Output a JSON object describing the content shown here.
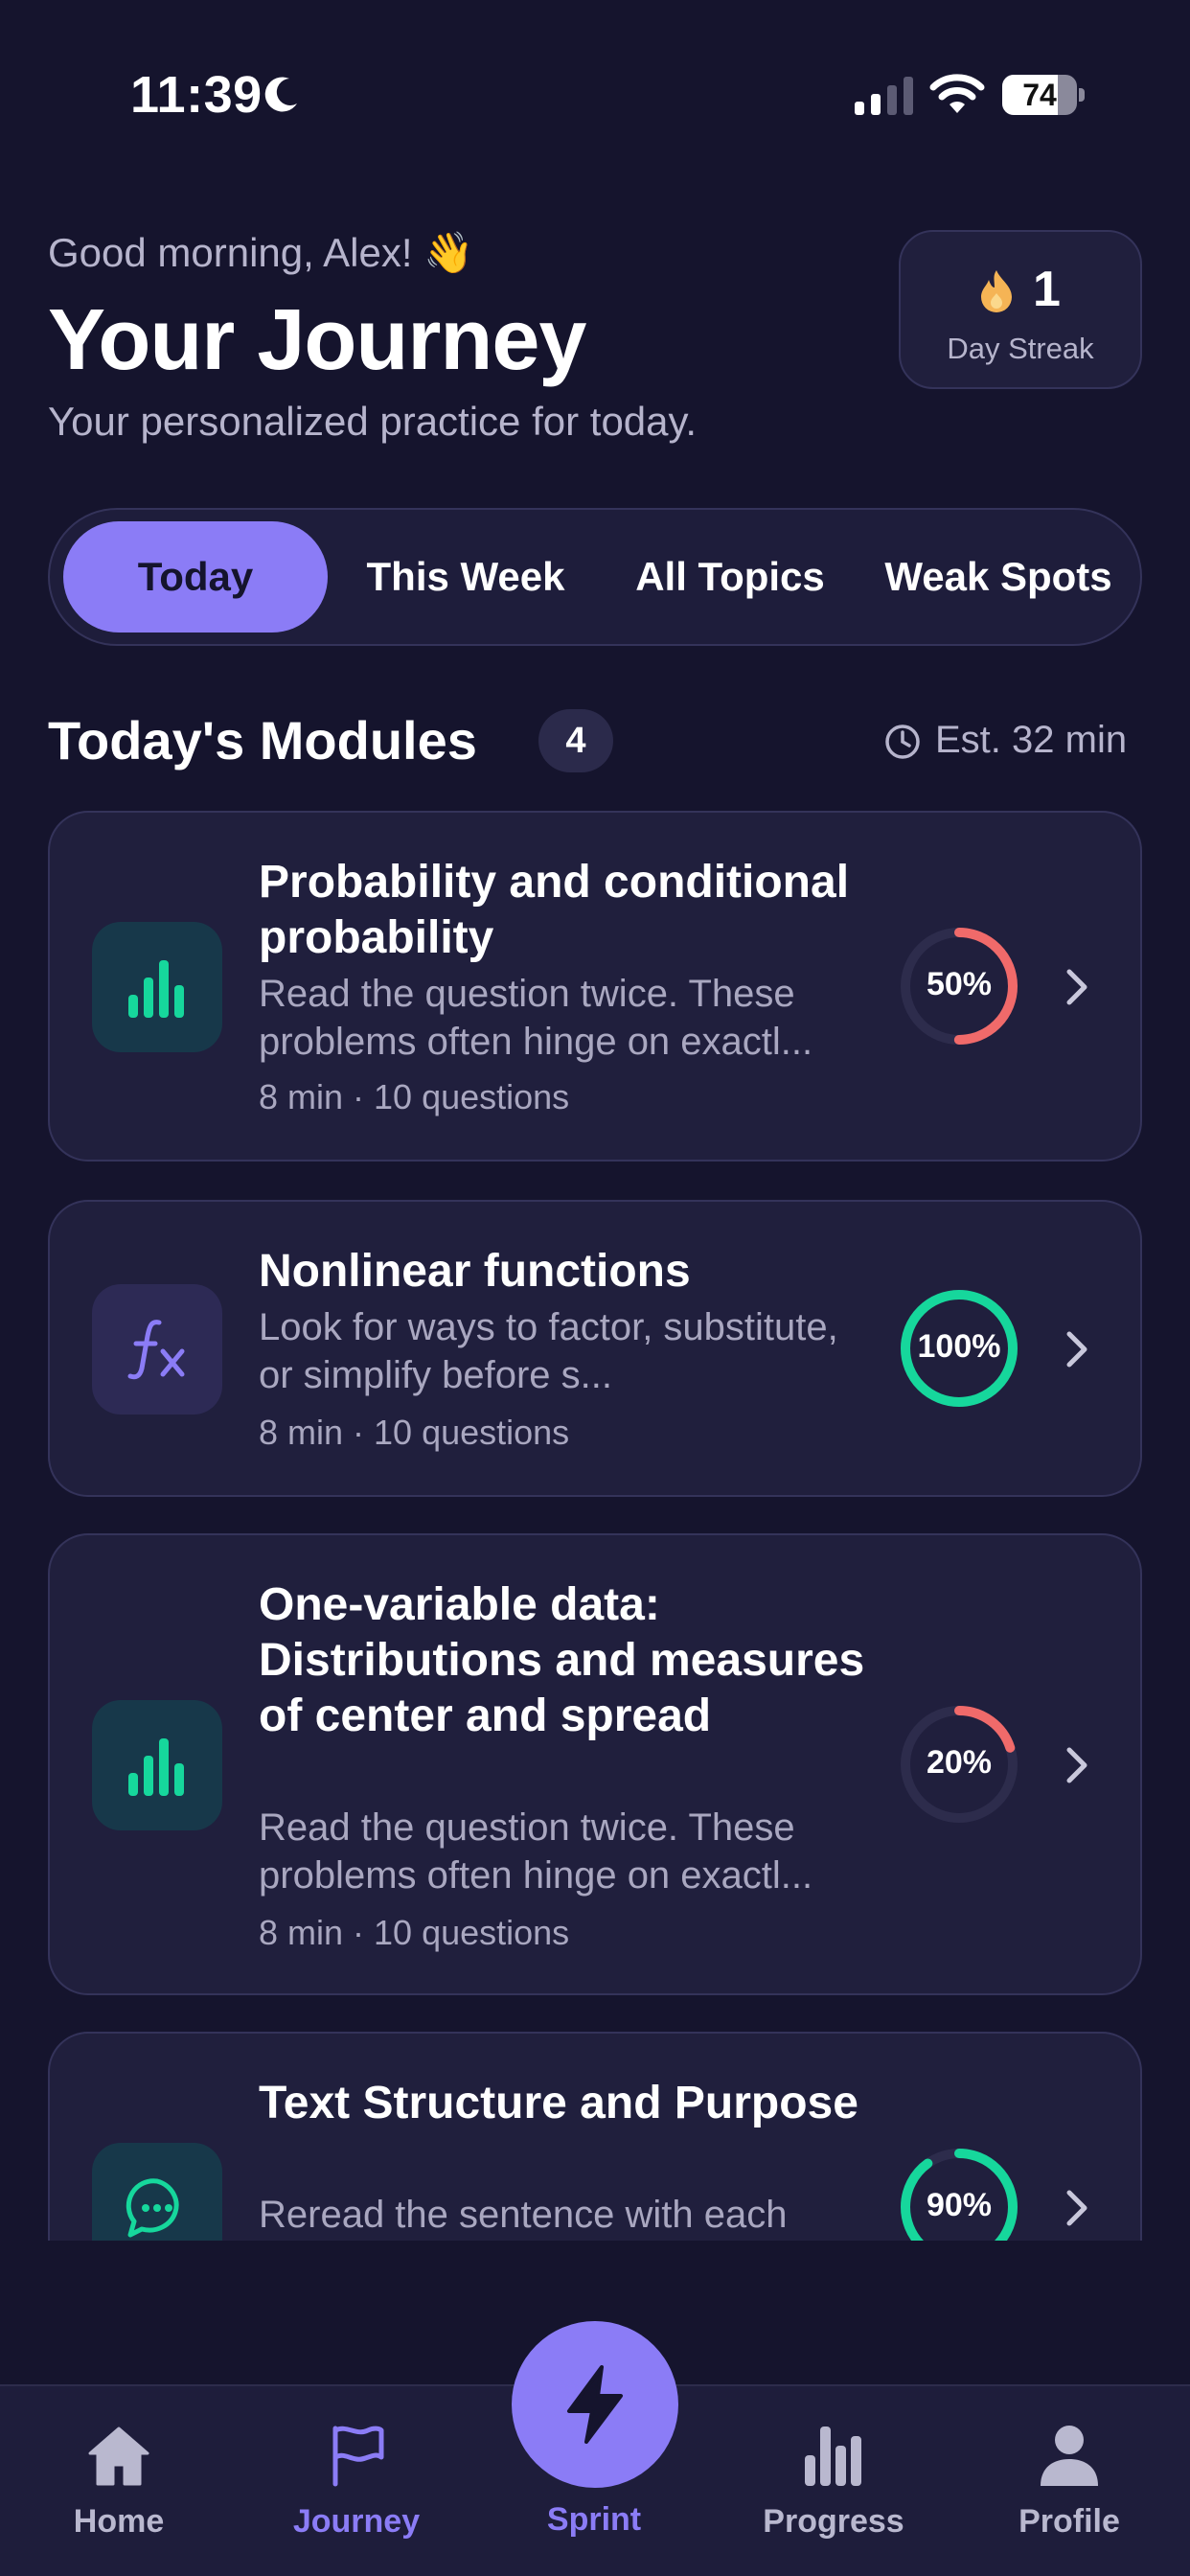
{
  "status_bar": {
    "time": "11:39",
    "battery": "74",
    "battery_level": 0.74
  },
  "header": {
    "greeting": "Good morning, Alex! 👋",
    "title": "Your Journey",
    "subtitle": "Your personalized practice for today."
  },
  "streak": {
    "count": "1",
    "label": "Day Streak"
  },
  "tabs": [
    {
      "label": "Today",
      "active": true
    },
    {
      "label": "This Week",
      "active": false
    },
    {
      "label": "All Topics",
      "active": false
    },
    {
      "label": "Weak Spots",
      "active": false
    }
  ],
  "section": {
    "title": "Today's Modules",
    "count": "4",
    "estimate": "Est. 32 min"
  },
  "modules": [
    {
      "title": "Probability and conditional probability",
      "description": "Read the question twice. These problems often hinge on exactl...",
      "meta": "8 min · 10 questions",
      "progress_label": "50%",
      "progress": 0.5,
      "icon": "bar-chart-icon"
    },
    {
      "title": "Nonlinear functions",
      "description": "Look for ways to factor, substitute, or simplify before s...",
      "meta": "8 min · 10 questions",
      "progress_label": "100%",
      "progress": 1.0,
      "icon": "function-icon"
    },
    {
      "title": "One-variable data: Distributions and measures of center and spread",
      "description": "Read the question twice. These problems often hinge on exactl...",
      "meta": "8 min · 10 questions",
      "progress_label": "20%",
      "progress": 0.2,
      "icon": "bar-chart-icon"
    },
    {
      "title": "Text Structure and Purpose",
      "description": "Reread the sentence with each",
      "meta": "",
      "progress_label": "90%",
      "progress": 0.9,
      "icon": "chat-bubble-icon"
    }
  ],
  "nav": {
    "home": "Home",
    "journey": "Journey",
    "sprint": "Sprint",
    "progress": "Progress",
    "profile": "Profile"
  },
  "colors": {
    "background": "#15142d",
    "card": "#201f3d",
    "accent": "#8b7cf6",
    "success": "#16d79c",
    "warning": "#f06a6a",
    "text_muted": "#b6b4cc"
  }
}
